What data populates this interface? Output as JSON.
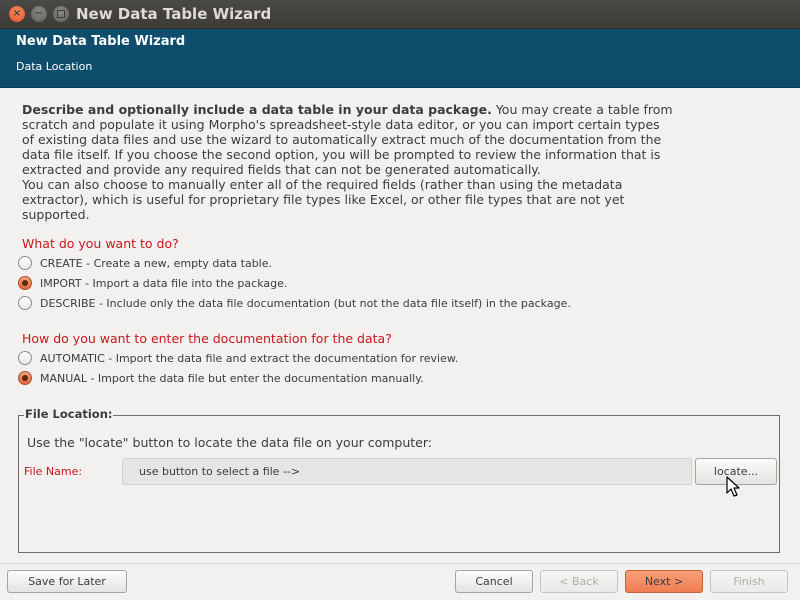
{
  "window": {
    "title": "New Data Table Wizard",
    "controls": {
      "close": "×",
      "minimize": "−"
    }
  },
  "header": {
    "title": "New Data Table Wizard",
    "subtitle": "Data Location"
  },
  "description": {
    "bold": "Describe and optionally include a data table in your data package.",
    "line1_rest": " You may create a table from",
    "line2": "scratch and populate it using Morpho's spreadsheet-style data editor, or you can import certain types",
    "line3": "of existing data files and use the wizard to automatically extract much of the documentation from the",
    "line4": "data file itself. If you choose the second option, you will be prompted to review the information that is",
    "line5": "extracted and provide any required fields that can not be generated automatically.",
    "line6": "You can also choose to manually enter all of the required fields (rather than using the metadata",
    "line7": "extractor), which is useful for proprietary file types like Excel, or other file types that are not yet",
    "line8": "supported."
  },
  "action_question": "What do you want to do?",
  "action_options": [
    {
      "label": "CREATE - Create a new, empty data table.",
      "selected": false
    },
    {
      "label": "IMPORT - Import a data file into the package.",
      "selected": true
    },
    {
      "label": "DESCRIBE - Include only the data file documentation (but not the data file itself) in the package.",
      "selected": false
    }
  ],
  "doc_question": "How do you want to enter the documentation for the data?",
  "doc_options": [
    {
      "label": "AUTOMATIC - Import the data file and extract the documentation for review.",
      "selected": false
    },
    {
      "label": "MANUAL - Import the data file but enter the documentation manually.",
      "selected": true
    }
  ],
  "file_location": {
    "legend": "File Location:",
    "hint": "Use the \"locate\" button to locate the data file on your computer:",
    "file_name_label": "File Name:",
    "file_name_value": "use button to select a file -->",
    "locate_label": "locate..."
  },
  "footer": {
    "save_later": "Save for Later",
    "cancel": "Cancel",
    "back": "< Back",
    "next": "Next >",
    "finish": "Finish"
  },
  "colors": {
    "header_bg": "#0e4d6b",
    "accent_red": "#c8161d",
    "primary_button": "#ef7c51"
  }
}
